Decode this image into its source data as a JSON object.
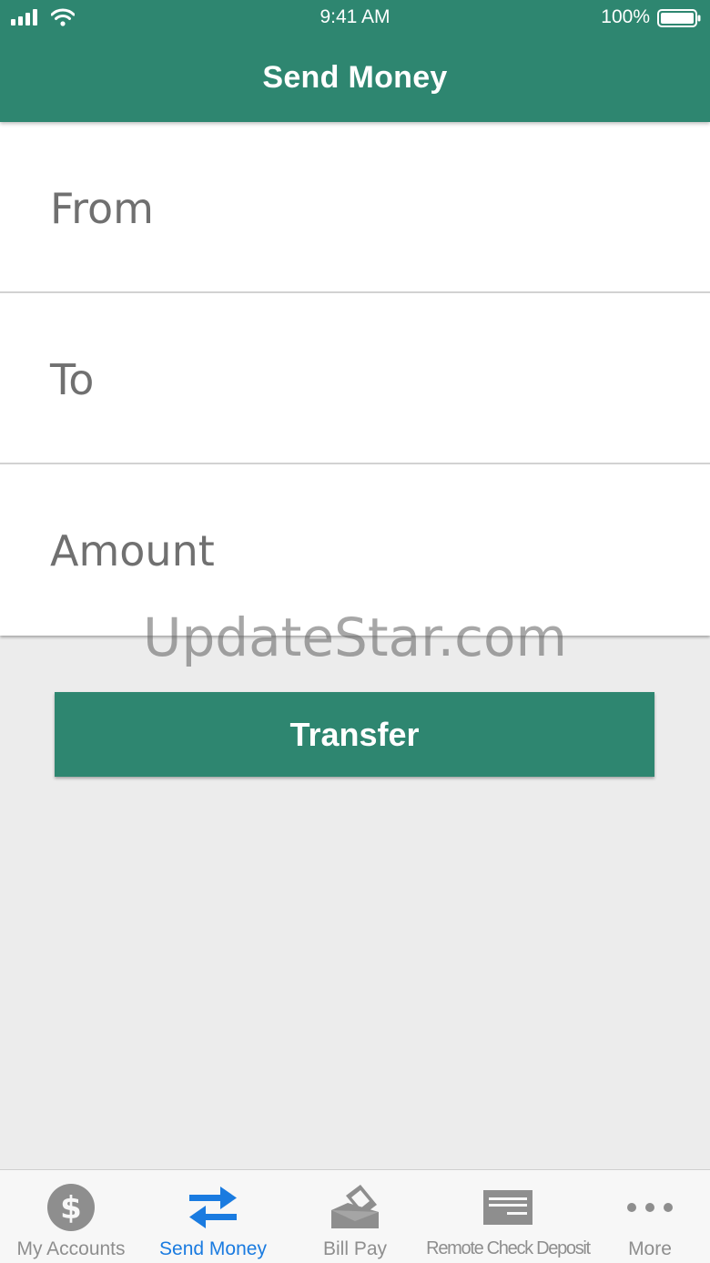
{
  "status_bar": {
    "time": "9:41 AM",
    "battery": "100%"
  },
  "header": {
    "title": "Send Money"
  },
  "form": {
    "from_label": "From",
    "to_label": "To",
    "amount_label": "Amount"
  },
  "watermark": "UpdateStar.com",
  "transfer_button": "Transfer",
  "tab_bar": {
    "items": [
      {
        "label": "My Accounts",
        "icon": "dollar-circle-icon",
        "active": false
      },
      {
        "label": "Send Money",
        "icon": "transfer-arrows-icon",
        "active": true
      },
      {
        "label": "Bill Pay",
        "icon": "bill-pay-icon",
        "active": false
      },
      {
        "label": "Remote Check Deposit",
        "icon": "check-icon",
        "active": false
      },
      {
        "label": "More",
        "icon": "more-dots-icon",
        "active": false
      }
    ]
  },
  "colors": {
    "brand": "#2e8670",
    "active_tab": "#1a7be0",
    "inactive_tab": "#8e8e8e",
    "background": "#ececec"
  }
}
